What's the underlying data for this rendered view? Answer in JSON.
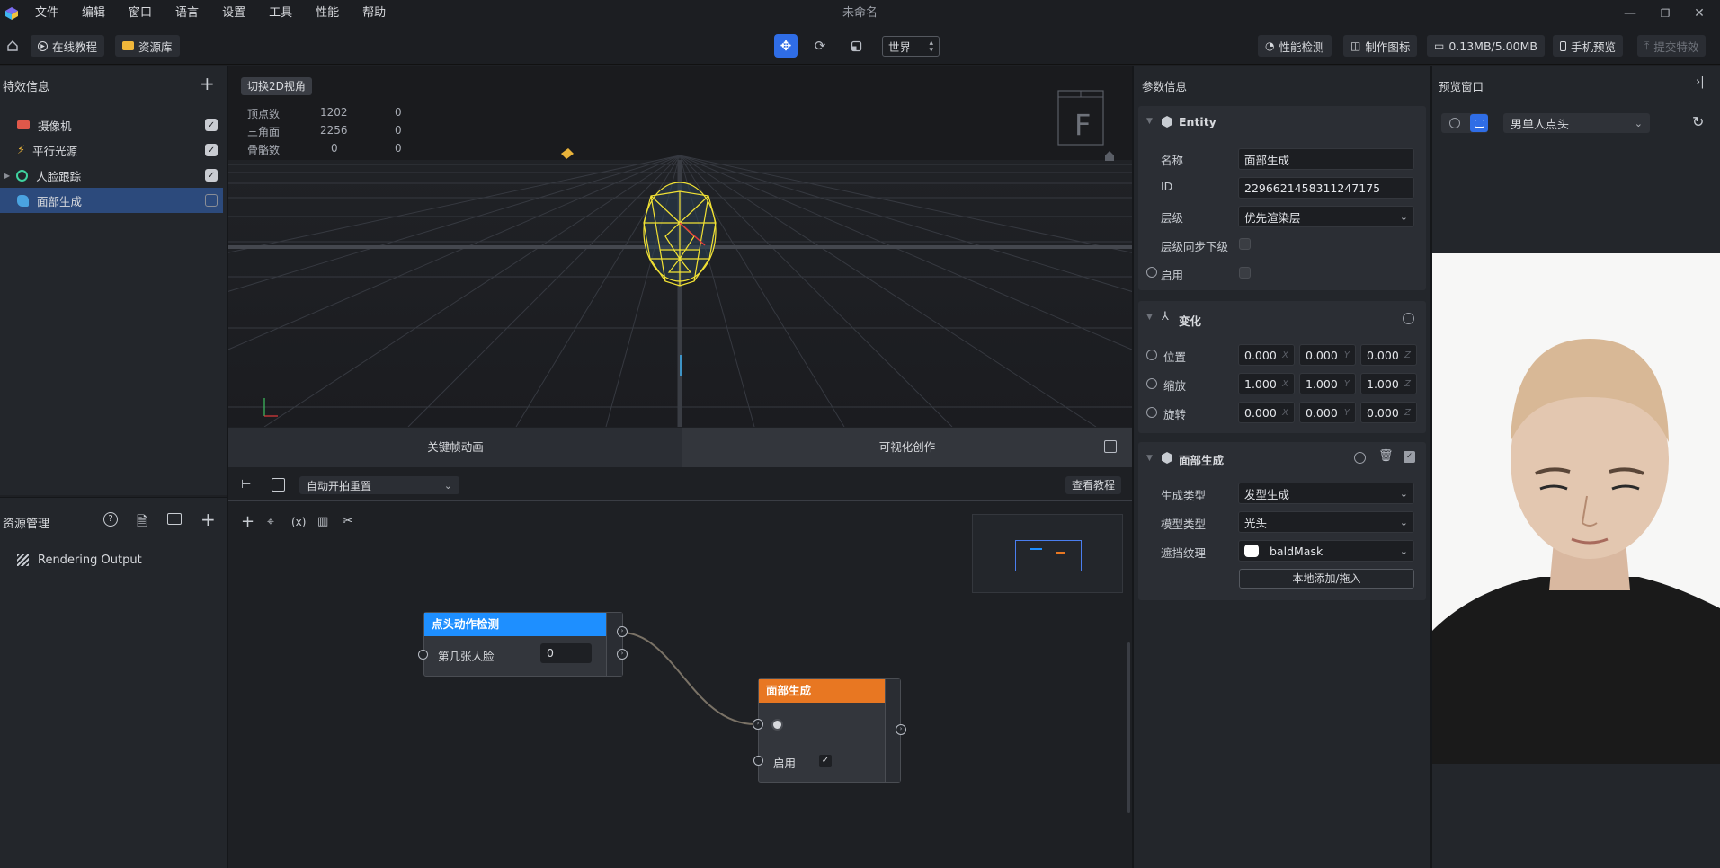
{
  "window": {
    "title": "未命名",
    "minimize": "—",
    "restore": "❐",
    "close": "✕"
  },
  "menu": [
    "文件",
    "编辑",
    "窗口",
    "语言",
    "设置",
    "工具",
    "性能",
    "帮助"
  ],
  "toolbar": {
    "online_tutorial": "在线教程",
    "asset_library": "资源库",
    "space_select": "世界",
    "perf_check": "性能检测",
    "make_icon": "制作图标",
    "memory": "0.13MB/5.00MB",
    "phone_preview": "手机预览",
    "submit": "提交特效"
  },
  "effects_panel": {
    "title": "特效信息",
    "items": [
      {
        "label": "摄像机",
        "checked": true,
        "icon": "camera-icon",
        "color": "#e0584a"
      },
      {
        "label": "平行光源",
        "checked": true,
        "icon": "light-icon",
        "color": "#e8b23a"
      },
      {
        "label": "人脸跟踪",
        "checked": true,
        "icon": "face-track-icon",
        "color": "#3fd3a0"
      },
      {
        "label": "面部生成",
        "checked": false,
        "icon": "face-gen-icon",
        "color": "#4aa3e0"
      }
    ]
  },
  "viewport": {
    "toggle_2d": "切换2D视角",
    "stats": [
      {
        "label": "顶点数",
        "v1": "1202",
        "v2": "0"
      },
      {
        "label": "三角面",
        "v1": "2256",
        "v2": "0"
      },
      {
        "label": "骨骼数",
        "v1": "0",
        "v2": "0"
      }
    ],
    "gizmo_label": "F"
  },
  "tabs": {
    "keyframe": "关键帧动画",
    "visual": "可视化创作"
  },
  "graph_toolbar": {
    "select": "自动开拍重置",
    "view_tutorial": "查看教程"
  },
  "assets_panel": {
    "title": "资源管理",
    "items": [
      "Rendering Output"
    ]
  },
  "nodes": {
    "nod": {
      "title": "点头动作检测",
      "field_label": "第几张人脸",
      "field_value": "0",
      "color": "#1e8fff"
    },
    "facegen": {
      "title": "面部生成",
      "enable_label": "启用",
      "color": "#e87722"
    }
  },
  "params": {
    "title": "参数信息",
    "entity": {
      "header": "Entity",
      "name_label": "名称",
      "name_value": "面部生成",
      "id_label": "ID",
      "id_value": "2296621458311247175",
      "layer_label": "层级",
      "layer_value": "优先渲染层",
      "layer_sync_label": "层级同步下级",
      "enable_label": "启用"
    },
    "transform": {
      "header": "变化",
      "position_label": "位置",
      "position": [
        "0.000",
        "0.000",
        "0.000"
      ],
      "scale_label": "缩放",
      "scale": [
        "1.000",
        "1.000",
        "1.000"
      ],
      "rotation_label": "旋转",
      "rotation": [
        "0.000",
        "0.000",
        "0.000"
      ],
      "axes": [
        "X",
        "Y",
        "Z"
      ]
    },
    "facegen": {
      "header": "面部生成",
      "gen_type_label": "生成类型",
      "gen_type_value": "发型生成",
      "model_type_label": "模型类型",
      "model_type_value": "光头",
      "mask_label": "遮挡纹理",
      "mask_value": "baldMask",
      "add_local": "本地添加/拖入"
    }
  },
  "preview": {
    "title": "预览窗口",
    "select": "男单人点头"
  }
}
